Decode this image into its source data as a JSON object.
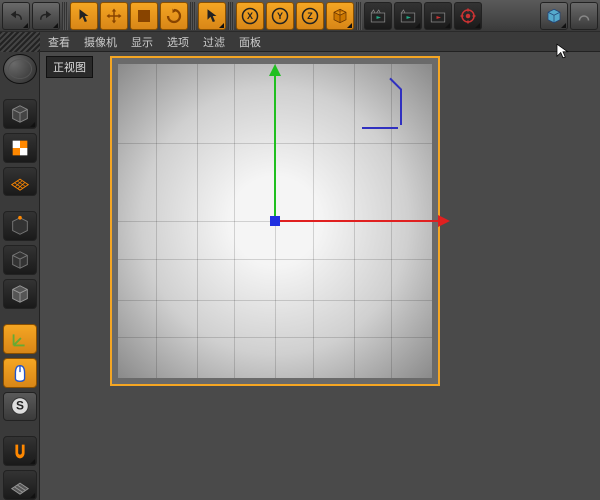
{
  "toolbar": {
    "undo": "undo",
    "redo": "redo",
    "select": "select",
    "move": "move",
    "scale": "scale",
    "rotate": "rotate",
    "lasttool": "lasttool",
    "x": "X",
    "y": "Y",
    "z": "Z",
    "cube3d": "cube3d",
    "clap1": "render",
    "clap2": "render-region",
    "clap3": "render-settings",
    "gear": "render-queue",
    "cube_blue": "primitive"
  },
  "menu": {
    "view": "查看",
    "camera": "摄像机",
    "display": "显示",
    "options": "选项",
    "filter": "过滤",
    "panel": "面板"
  },
  "viewport": {
    "label": "正视图"
  },
  "sidebar": {
    "cube1": "live-select",
    "checker": "material",
    "grid": "floor",
    "point": "point",
    "edge": "edge",
    "poly": "polygon",
    "axis": "axis",
    "mouse": "tweak",
    "snap": "S",
    "magnet": "magnet",
    "workplane": "workplane"
  }
}
